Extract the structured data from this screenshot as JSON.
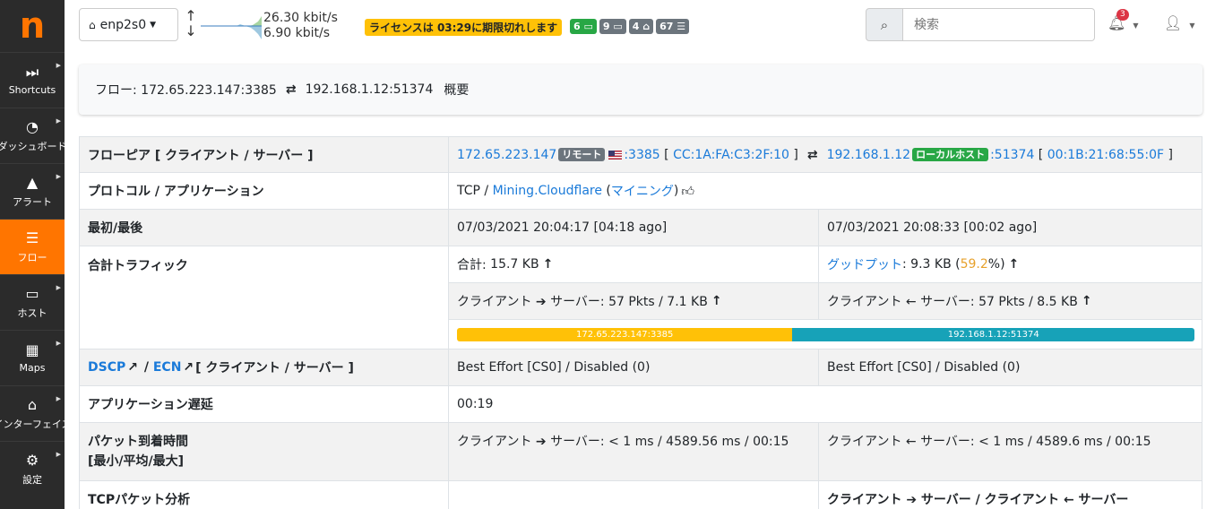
{
  "sidebar": {
    "logo": "n",
    "items": [
      {
        "label": "Shortcuts",
        "icon": "fast-forward-icon"
      },
      {
        "label": "ダッシュボード",
        "icon": "dashboard-icon"
      },
      {
        "label": "アラート",
        "icon": "warning-icon"
      },
      {
        "label": "フロー",
        "icon": "stream-icon"
      },
      {
        "label": "ホスト",
        "icon": "laptop-icon"
      },
      {
        "label": "Maps",
        "icon": "map-icon"
      },
      {
        "label": "インターフェイス",
        "icon": "ethernet-icon"
      },
      {
        "label": "設定",
        "icon": "gear-icon"
      }
    ]
  },
  "topbar": {
    "interface": "enp2s0",
    "rate_up": "26.30 kbit/s",
    "rate_down": "6.90 kbit/s",
    "license": "ライセンスは 03:29に期限切れします",
    "badges": [
      "6",
      "9",
      "4",
      "67"
    ],
    "search_placeholder": "検索",
    "notifications": "3"
  },
  "breadcrumb": {
    "prefix": "フロー: 172.65.223.147:3385",
    "target": "192.168.1.12:51374",
    "summary": "概要"
  },
  "flow": {
    "row1_label": "フローピア [ クライアント / サーバー ]",
    "client_ip": "172.65.223.147",
    "remote_tag": "リモート",
    "client_port": ":3385",
    "client_mac": "CC:1A:FA:C3:2F:10",
    "server_ip": "192.168.1.12",
    "local_tag": "ローカルホスト",
    "server_port": ":51374",
    "server_mac": "00:1B:21:68:55:0F",
    "row2_label": "プロトコル / アプリケーション",
    "proto": "TCP",
    "app": "Mining.Cloudflare",
    "category": "マイニング",
    "row3_label": "最初/最後",
    "first_seen": "07/03/2021 20:04:17 [04:18 ago]",
    "last_seen": "07/03/2021 20:08:33 [00:02 ago]",
    "row4_label": "合計トラフィック",
    "total_label": "合計:",
    "total_value": "15.7 KB",
    "goodput_label": "グッドプット",
    "goodput_value": ": 9.3 KB (",
    "goodput_pct": "59.2",
    "goodput_tail": " %)",
    "c2s": "クライアント ➔ サーバー: 57 Pkts / 7.1 KB",
    "s2c": "クライアント ← サーバー: 57 Pkts / 8.5 KB",
    "bar_left": "172.65.223.147:3385",
    "bar_right": "192.168.1.12:51374",
    "bar_left_fraction": 0.455,
    "dscp": "DSCP",
    "ecn": "ECN",
    "dscp_tail": " [ クライアント / サーバー ]",
    "dscp_client": "Best Effort [CS0] / Disabled (0)",
    "dscp_server": "Best Effort [CS0] / Disabled (0)",
    "latency_label": "アプリケーション遅延",
    "latency_value": "00:19",
    "iat_label_1": "パケット到着時間",
    "iat_label_2": "[最小/平均/最大]",
    "iat_c2s": "クライアント ➔ サーバー: < 1 ms / 4589.56 ms / 00:15",
    "iat_s2c": "クライアント ← サーバー: < 1 ms / 4589.6 ms / 00:15",
    "tcp_label": "TCPパケット分析",
    "tcp_header": "クライアント ➔ サーバー / クライアント ← サーバー"
  }
}
